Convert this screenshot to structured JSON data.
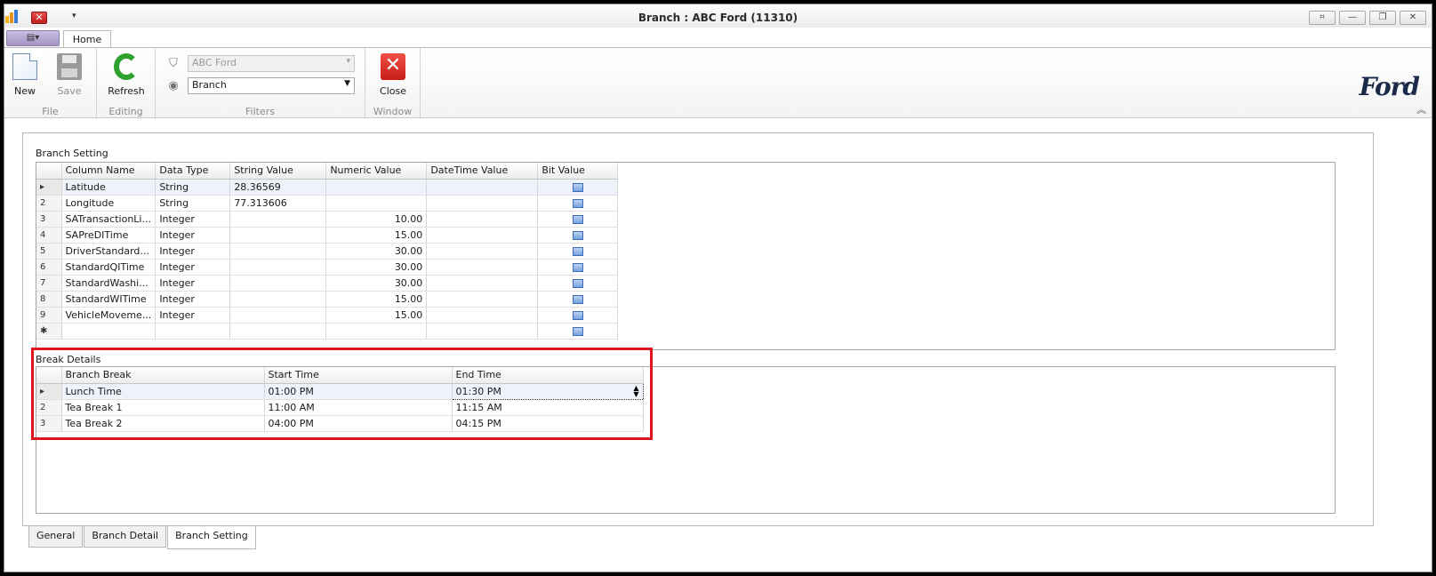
{
  "window": {
    "title": "Branch : ABC Ford (11310)",
    "qat_dropdown": "▾",
    "controls": [
      "⌗",
      "—",
      "❐",
      "✕"
    ]
  },
  "ribbon_tabs": {
    "app_menu": "▤▾",
    "home": "Home"
  },
  "ribbon": {
    "groups": {
      "file": "File",
      "editing": "Editing",
      "filters": "Filters",
      "window": "Window"
    },
    "buttons": {
      "new": "New",
      "save": "Save",
      "refresh": "Refresh",
      "close": "Close"
    },
    "filters": {
      "dealer_value": "ABC Ford",
      "view_value": "Branch"
    },
    "brand": "Ford",
    "collapse_glyph": "︽"
  },
  "branch_setting": {
    "caption": "Branch Setting",
    "columns": [
      "Column Name",
      "Data Type",
      "String Value",
      "Numeric Value",
      "DateTime Value",
      "Bit Value"
    ],
    "rows": [
      {
        "ind": "▸",
        "name": "Latitude",
        "type": "String",
        "string": "28.36569",
        "numeric": "",
        "datetime": ""
      },
      {
        "ind": "2",
        "name": "Longitude",
        "type": "String",
        "string": "77.313606",
        "numeric": "",
        "datetime": ""
      },
      {
        "ind": "3",
        "name": "SATransactionLi...",
        "type": "Integer",
        "string": "",
        "numeric": "10.00",
        "datetime": ""
      },
      {
        "ind": "4",
        "name": "SAPreDITime",
        "type": "Integer",
        "string": "",
        "numeric": "15.00",
        "datetime": ""
      },
      {
        "ind": "5",
        "name": "DriverStandard...",
        "type": "Integer",
        "string": "",
        "numeric": "30.00",
        "datetime": ""
      },
      {
        "ind": "6",
        "name": "StandardQITime",
        "type": "Integer",
        "string": "",
        "numeric": "30.00",
        "datetime": ""
      },
      {
        "ind": "7",
        "name": "StandardWashi...",
        "type": "Integer",
        "string": "",
        "numeric": "30.00",
        "datetime": ""
      },
      {
        "ind": "8",
        "name": "StandardWITime",
        "type": "Integer",
        "string": "",
        "numeric": "15.00",
        "datetime": ""
      },
      {
        "ind": "9",
        "name": "VehicleMoveme...",
        "type": "Integer",
        "string": "",
        "numeric": "15.00",
        "datetime": ""
      },
      {
        "ind": "✱",
        "name": "",
        "type": "",
        "string": "",
        "numeric": "",
        "datetime": ""
      }
    ]
  },
  "break_details": {
    "caption": "Break Details",
    "columns": [
      "Branch Break",
      "Start Time",
      "End Time"
    ],
    "rows": [
      {
        "ind": "▸",
        "break": "Lunch Time",
        "start": "01:00 PM",
        "end": "01:30 PM"
      },
      {
        "ind": "2",
        "break": "Tea Break 1",
        "start": "11:00 AM",
        "end": "11:15 AM"
      },
      {
        "ind": "3",
        "break": "Tea Break 2",
        "start": "04:00 PM",
        "end": "04:15 PM"
      }
    ]
  },
  "bottom_tabs": [
    "General",
    "Branch Detail",
    "Branch Setting"
  ],
  "colors": {
    "highlight": "#e0141e",
    "bit_value": "#7aa2dc"
  }
}
